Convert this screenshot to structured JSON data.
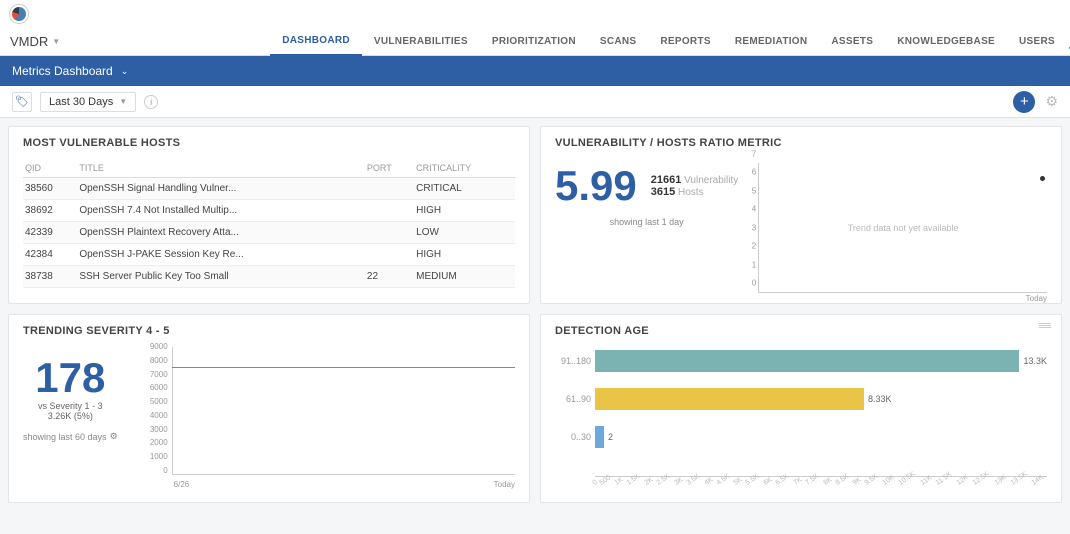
{
  "brand": "VMDR",
  "nav": {
    "tabs": [
      "DASHBOARD",
      "VULNERABILITIES",
      "PRIORITIZATION",
      "SCANS",
      "REPORTS",
      "REMEDIATION",
      "ASSETS",
      "KNOWLEDGEBASE",
      "USERS"
    ]
  },
  "bluebar": {
    "title": "Metrics Dashboard"
  },
  "filter": {
    "range": "Last 30 Days"
  },
  "hosts": {
    "title": "MOST VULNERABLE HOSTS",
    "cols": [
      "QID",
      "TITLE",
      "PORT",
      "CRITICALITY"
    ],
    "rows": [
      {
        "qid": "38560",
        "title": "OpenSSH Signal Handling Vulner...",
        "port": "",
        "crit": "CRITICAL"
      },
      {
        "qid": "38692",
        "title": "OpenSSH 7.4 Not Installed Multip...",
        "port": "",
        "crit": "HIGH"
      },
      {
        "qid": "42339",
        "title": "OpenSSH Plaintext Recovery Atta...",
        "port": "",
        "crit": "LOW"
      },
      {
        "qid": "42384",
        "title": "OpenSSH J-PAKE Session Key Re...",
        "port": "",
        "crit": "HIGH"
      },
      {
        "qid": "38738",
        "title": "SSH Server Public Key Too Small",
        "port": "22",
        "crit": "MEDIUM"
      }
    ]
  },
  "ratio": {
    "title": "VULNERABILITY / HOSTS RATIO METRIC",
    "value": "5.99",
    "vuln_count": "21661",
    "vuln_label": "Vulnerability",
    "host_count": "3615",
    "host_label": "Hosts",
    "sub": "showing last 1 day",
    "trend": "Trend data not yet available",
    "xend": "Today",
    "chart_data": {
      "type": "line",
      "ylim": [
        0,
        7
      ],
      "yticks": [
        "0",
        "1",
        "2",
        "3",
        "4",
        "5",
        "6",
        "7"
      ],
      "points": [
        {
          "x": 1,
          "y": 6
        }
      ]
    }
  },
  "severity": {
    "title": "TRENDING SEVERITY 4 - 5",
    "value": "178",
    "sub1": "vs Severity 1 - 3",
    "sub2": "3.26K (5%)",
    "last": "showing last 60 days",
    "xstart": "6/26",
    "xend": "Today",
    "chart_data": {
      "type": "line",
      "ylim": [
        0,
        9000
      ],
      "yticks": [
        "0",
        "1000",
        "2000",
        "3000",
        "4000",
        "5000",
        "6000",
        "7000",
        "8000",
        "9000"
      ],
      "series": [
        {
          "name": "sev4-5",
          "values_approx": "flat≈7800"
        }
      ]
    }
  },
  "detection": {
    "title": "DETECTION AGE",
    "chart_data": {
      "type": "bar",
      "orientation": "horizontal",
      "categories": [
        "91..180",
        "61..90",
        "0..30"
      ],
      "values": [
        13300,
        8330,
        2
      ],
      "value_labels": [
        "13.3K",
        "8.33K",
        "2"
      ],
      "colors": [
        "#7bb3b3",
        "#e8c547",
        "#6fa8dc"
      ],
      "xlim": [
        0,
        14000
      ],
      "xticks": [
        "0",
        "500",
        "1K",
        "1.5K",
        "2K",
        "2.5K",
        "3K",
        "3.5K",
        "4K",
        "4.5K",
        "5K",
        "5.5K",
        "6K",
        "6.5K",
        "7K",
        "7.5K",
        "8K",
        "8.5K",
        "9K",
        "9.5K",
        "10K",
        "10.5K",
        "11K",
        "11.5K",
        "12K",
        "12.5K",
        "13K",
        "13.5K",
        "14K"
      ]
    }
  },
  "chart_data": [
    {
      "id": "ratio",
      "type": "line",
      "ylim": [
        0,
        7
      ],
      "data": [
        {
          "x": "Today",
          "y": 6
        }
      ]
    },
    {
      "id": "severity_trend",
      "type": "line",
      "ylim": [
        0,
        9000
      ],
      "approx_value": 7800
    },
    {
      "id": "detection_age",
      "type": "bar",
      "categories": [
        "91..180",
        "61..90",
        "0..30"
      ],
      "values": [
        13300,
        8330,
        2
      ]
    }
  ]
}
